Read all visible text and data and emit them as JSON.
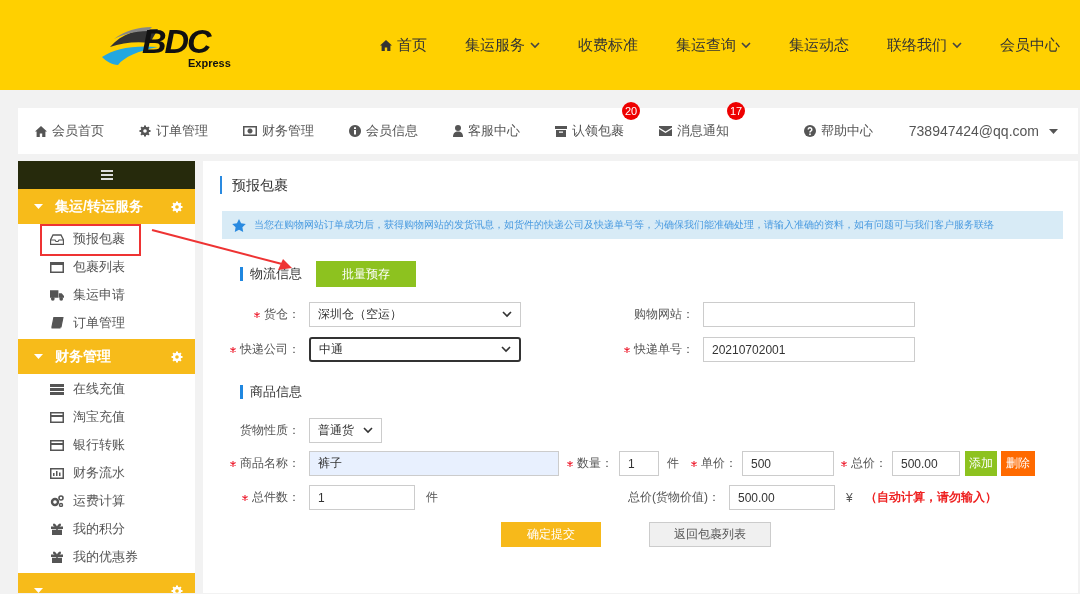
{
  "header": {
    "logo": {
      "text": "BDC",
      "subtext": "Express"
    },
    "nav": [
      {
        "label": "首页",
        "dropdown": false
      },
      {
        "label": "集运服务",
        "dropdown": true
      },
      {
        "label": "收费标准",
        "dropdown": false
      },
      {
        "label": "集运查询",
        "dropdown": true
      },
      {
        "label": "集运动态",
        "dropdown": false
      },
      {
        "label": "联络我们",
        "dropdown": true
      },
      {
        "label": "会员中心",
        "dropdown": false
      }
    ]
  },
  "member_nav": {
    "items": [
      {
        "label": "会员首页"
      },
      {
        "label": "订单管理"
      },
      {
        "label": "财务管理"
      },
      {
        "label": "会员信息"
      },
      {
        "label": "客服中心"
      },
      {
        "label": "认领包裹",
        "badge": "20"
      },
      {
        "label": "消息通知",
        "badge": "17"
      }
    ],
    "help": "帮助中心",
    "account": "738947424@qq.com"
  },
  "sidebar": {
    "sections": [
      {
        "title": "集运/转运服务",
        "expanded": true,
        "items": [
          "预报包裹",
          "包裹列表",
          "集运申请",
          "订单管理"
        ]
      },
      {
        "title": "财务管理",
        "expanded": true,
        "items": [
          "在线充值",
          "淘宝充值",
          "银行转账",
          "财务流水",
          "运费计算",
          "我的积分",
          "我的优惠券"
        ]
      },
      {
        "expanded": true
      }
    ]
  },
  "main": {
    "title": "预报包裹",
    "notice": "当您在购物网站订单成功后，获得购物网站的发货讯息，如货件的快递公司及快递单号等，为确保我们能准确处理，请输入准确的资料，如有问题可与我们客户服务联络",
    "logistics": {
      "heading": "物流信息",
      "batch_button": "批量预存",
      "fields": [
        {
          "kind": "select",
          "label": "货仓：",
          "required": true,
          "value": "深圳仓（空运）",
          "focused": false
        },
        {
          "kind": "text",
          "label": "购物网站：",
          "required": false,
          "focused": false
        },
        {
          "kind": "select",
          "label": "快递公司：",
          "required": true,
          "value": "中通",
          "focused": true
        },
        {
          "kind": "text",
          "label": "快递单号：",
          "required": true,
          "value": "20210702001",
          "focused": false
        }
      ]
    },
    "goods": {
      "heading": "商品信息",
      "nature": {
        "label": "货物性质：",
        "required": false,
        "value": "普通货"
      },
      "name": {
        "label": "商品名称：",
        "required": true,
        "value": "裤子",
        "autofilled": true
      },
      "quantity": {
        "label": "数量：",
        "required": true,
        "value": "1",
        "unit": "件"
      },
      "unit_price": {
        "label": "单价：",
        "required": true,
        "value": "500"
      },
      "total": {
        "label": "总价：",
        "required": true,
        "value": "500.00"
      },
      "add_button": "添加",
      "delete_button": "删除",
      "total_count": {
        "label": "总件数：",
        "required": true,
        "value": "1",
        "unit": "件"
      },
      "total_value": {
        "label": "总价(货物价值)：",
        "required": false,
        "value": "500.00",
        "currency": "¥",
        "note": "（自动计算，请勿输入）"
      }
    },
    "actions": {
      "submit": "确定提交",
      "back": "返回包裹列表"
    }
  }
}
